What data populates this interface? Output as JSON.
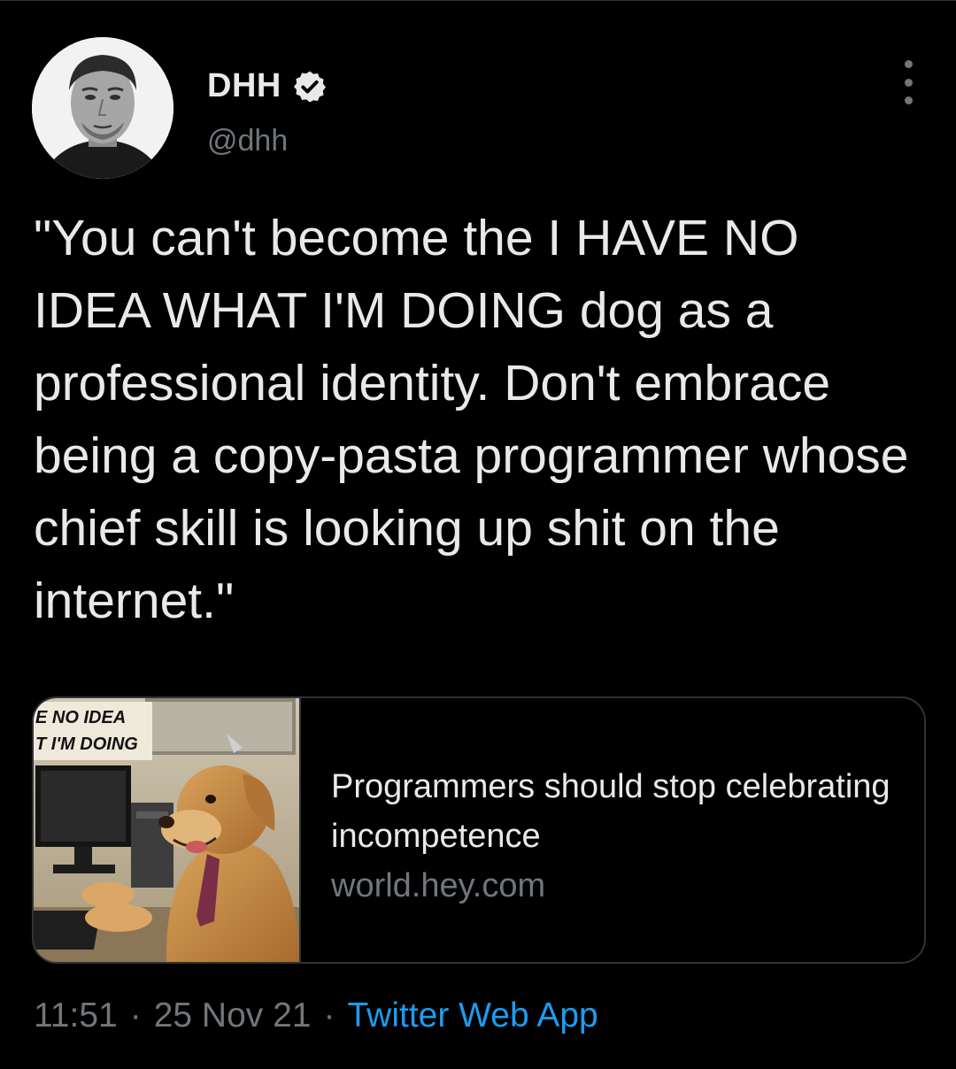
{
  "author": {
    "display_name": "DHH",
    "handle": "@dhh",
    "verified": true,
    "verified_icon": "verified-badge-icon"
  },
  "tweet": {
    "text": "\"You can't become the I HAVE NO IDEA WHAT I'M DOING dog as a professional identity. Don't embrace being a copy-pasta programmer whose chief skill is looking up shit on the internet.\""
  },
  "link_card": {
    "image_caption_line1": "E NO IDEA",
    "image_caption_line2": "T I'M DOING",
    "title": "Programmers should stop celebrating incompetence",
    "domain": "world.hey.com"
  },
  "footer": {
    "time": "11:51",
    "date": "25 Nov 21",
    "separator": "·",
    "source": "Twitter Web App"
  },
  "colors": {
    "background": "#000000",
    "text": "#e7e9ea",
    "secondary": "#71767b",
    "accent": "#1d9bf0",
    "border": "#2f3336"
  }
}
